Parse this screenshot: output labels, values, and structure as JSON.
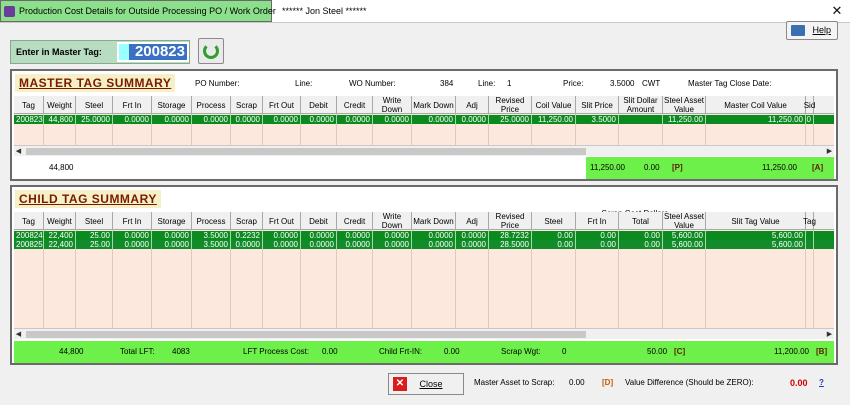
{
  "window": {
    "app_title": "Production Cost Details for Outside Processing PO / Work Order",
    "user": "****** Jon Steel ******",
    "close": "✕"
  },
  "help_label": "Help",
  "master_tag": {
    "label": "Enter in Master Tag:",
    "value": "200823"
  },
  "master_summary": {
    "title": "MASTER TAG SUMMARY",
    "po_label": "PO Number:",
    "line_label": "Line:",
    "wo_label": "WO Number:",
    "wo_value": "384",
    "line2_label": "Line:",
    "line2_value": "1",
    "price_label": "Price:",
    "price_value": "3.5000",
    "price_unit": "CWT",
    "close_date_label": "Master Tag Close Date:",
    "columns": [
      "Tag",
      "Weight",
      "Steel",
      "Frt In",
      "Storage",
      "Process",
      "Scrap",
      "Frt Out",
      "Debit",
      "Credit",
      "Write Down",
      "Mark Down",
      "Adj",
      "Revised Price",
      "Coil Value",
      "Slit Price",
      "Slit Dollar Amount",
      "Steel Asset Value",
      "Master Coil Value",
      "Sid"
    ],
    "rows": [
      [
        "200823",
        "44,800",
        "25.0000",
        "0.0000",
        "0.0000",
        "0.0000",
        "0.0000",
        "0.0000",
        "0.0000",
        "0.0000",
        "0.0000",
        "0.0000",
        "0.0000",
        "25.0000",
        "11,250.00",
        "3.5000",
        "",
        "11,250.00",
        "11,250.00",
        "0"
      ]
    ],
    "total_weight": "44,800",
    "sum_coil": "11,250.00",
    "sum_slit": "0.00",
    "tag_p": "[P]",
    "sum_master": "11,250.00",
    "tag_a": "[A]"
  },
  "child_summary": {
    "title": "CHILD TAG SUMMARY",
    "scrap_group": "Scrap Cost Dollars",
    "columns": [
      "Tag",
      "Weight",
      "Steel",
      "Frt In",
      "Storage",
      "Process",
      "Scrap",
      "Frt Out",
      "Debit",
      "Credit",
      "Write Down",
      "Mark Down",
      "Adj",
      "Revised Price",
      "Steel",
      "Frt In",
      "Total",
      "Steel Asset Value",
      "Slit Tag Value",
      "Tag"
    ],
    "rows": [
      [
        "200824",
        "22,400",
        "25.00",
        "0.0000",
        "0.0000",
        "3.5000",
        "0.2232",
        "0.0000",
        "0.0000",
        "0.0000",
        "0.0000",
        "0.0000",
        "0.0000",
        "28.7232",
        "0.00",
        "0.00",
        "0.00",
        "5,600.00",
        "5,600.00",
        ""
      ],
      [
        "200825",
        "22,400",
        "25.00",
        "0.0000",
        "0.0000",
        "3.5000",
        "0.0000",
        "0.0000",
        "0.0000",
        "0.0000",
        "0.0000",
        "0.0000",
        "0.0000",
        "28.5000",
        "0.00",
        "0.00",
        "0.00",
        "5,600.00",
        "5,600.00",
        ""
      ]
    ],
    "total_weight": "44,800",
    "total_lft_label": "Total LFT:",
    "total_lft": "4083",
    "lft_cost_label": "LFT Process Cost:",
    "lft_cost": "0.00",
    "child_frt_label": "Child Frt-IN:",
    "child_frt": "0.00",
    "scrap_wgt_label": "Scrap Wgt:",
    "scrap_wgt": "0",
    "scrap_total": "50.00",
    "tag_c": "[C]",
    "slit_total": "11,200.00",
    "tag_b": "[B]"
  },
  "footer": {
    "close_label": "Close",
    "master_asset_label": "Master Asset to Scrap:",
    "master_asset_value": "0.00",
    "tag_d": "[D]",
    "value_diff_label": "Value Difference (Should be ZERO):",
    "value_diff": "0.00",
    "q": "?"
  },
  "colors": {
    "row_green": "#0a8a1f",
    "summary_green": "#6ef04a",
    "grid_bg": "#fde8dd",
    "title_brown": "#7a1a00",
    "diff_red": "#d40000"
  }
}
